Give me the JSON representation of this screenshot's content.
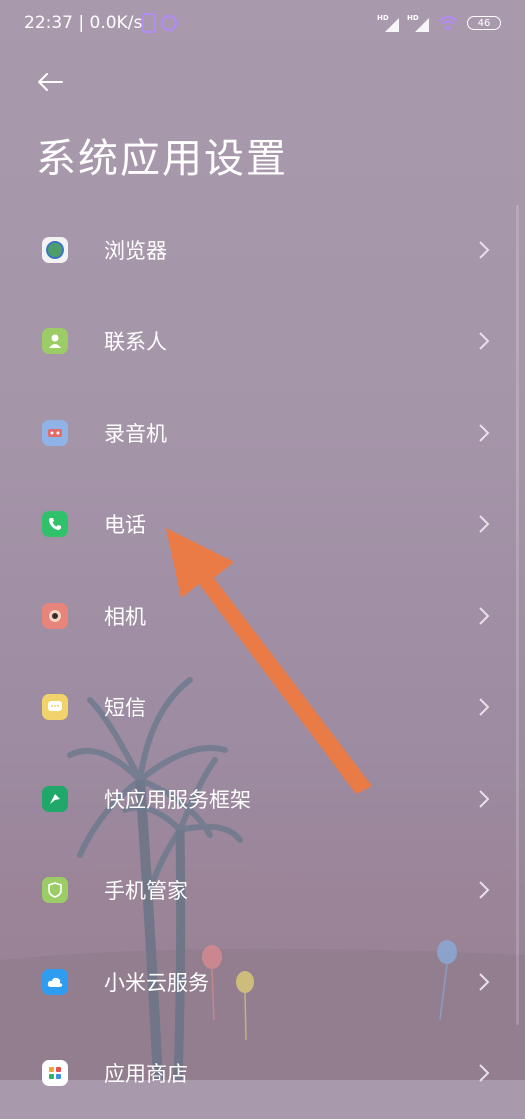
{
  "status_bar": {
    "time": "22:37 | 0.0K/s",
    "battery": "46"
  },
  "header": {
    "title": "系统应用设置"
  },
  "items": [
    {
      "label": "浏览器",
      "icon": "browser-icon",
      "color": "#f2f2f2"
    },
    {
      "label": "联系人",
      "icon": "contacts-icon",
      "color": "#9ccc65"
    },
    {
      "label": "录音机",
      "icon": "recorder-icon",
      "color": "#8fb3e6"
    },
    {
      "label": "电话",
      "icon": "phone-icon",
      "color": "#2fc26b"
    },
    {
      "label": "相机",
      "icon": "camera-icon",
      "color": "#e8857a"
    },
    {
      "label": "短信",
      "icon": "sms-icon",
      "color": "#f2d36b"
    },
    {
      "label": "快应用服务框架",
      "icon": "quickapp-icon",
      "color": "#1fa86a"
    },
    {
      "label": "手机管家",
      "icon": "security-icon",
      "color": "#9ccc65"
    },
    {
      "label": "小米云服务",
      "icon": "cloud-icon",
      "color": "#2e9df0"
    },
    {
      "label": "应用商店",
      "icon": "appstore-icon",
      "color": "#ffffff"
    }
  ],
  "colors": {
    "accent_arrow": "#f07a3e"
  }
}
